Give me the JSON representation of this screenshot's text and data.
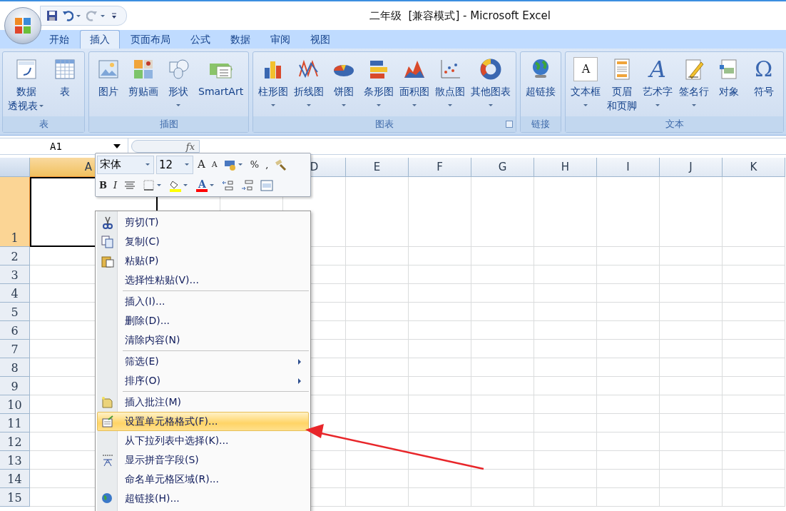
{
  "window": {
    "title": "二年级  [兼容模式] - Microsoft Excel"
  },
  "quick_access": [
    {
      "kind": "save"
    },
    {
      "kind": "undo",
      "dropdown": true
    },
    {
      "kind": "redo",
      "dropdown": true
    },
    {
      "kind": "customize"
    }
  ],
  "tabs": [
    {
      "label": "开始",
      "selected": false
    },
    {
      "label": "插入",
      "selected": true
    },
    {
      "label": "页面布局",
      "selected": false
    },
    {
      "label": "公式",
      "selected": false
    },
    {
      "label": "数据",
      "selected": false
    },
    {
      "label": "审阅",
      "selected": false
    },
    {
      "label": "视图",
      "selected": false
    }
  ],
  "ribbon_groups": [
    {
      "name": "表",
      "launcher": false,
      "buttons": [
        {
          "kind": "pivot",
          "label": "数据",
          "label2": "透视表",
          "dropdown": true
        },
        {
          "kind": "table",
          "label": "表",
          "dropdown": false
        }
      ]
    },
    {
      "name": "插图",
      "launcher": false,
      "buttons": [
        {
          "kind": "picture",
          "label": "图片",
          "dropdown": false
        },
        {
          "kind": "clipart",
          "label": "剪贴画",
          "dropdown": false
        },
        {
          "kind": "shapes",
          "label": "形状",
          "dropdown": true
        },
        {
          "kind": "smartart",
          "label": "SmartArt",
          "dropdown": false
        }
      ]
    },
    {
      "name": "图表",
      "launcher": true,
      "buttons": [
        {
          "kind": "column",
          "label": "柱形图",
          "dropdown": true
        },
        {
          "kind": "line",
          "label": "折线图",
          "dropdown": true
        },
        {
          "kind": "pie",
          "label": "饼图",
          "dropdown": true
        },
        {
          "kind": "bar",
          "label": "条形图",
          "dropdown": true
        },
        {
          "kind": "area",
          "label": "面积图",
          "dropdown": true
        },
        {
          "kind": "scatter",
          "label": "散点图",
          "dropdown": true
        },
        {
          "kind": "donut",
          "label": "其他图表",
          "dropdown": true
        }
      ]
    },
    {
      "name": "链接",
      "launcher": false,
      "buttons": [
        {
          "kind": "globe",
          "label": "超链接",
          "dropdown": false
        }
      ]
    },
    {
      "name": "文本",
      "launcher": false,
      "buttons": [
        {
          "kind": "textbox",
          "glyph": "A",
          "label": "文本框",
          "dropdown": true
        },
        {
          "kind": "header",
          "label": "页眉",
          "label2": "和页脚",
          "dropdown": false
        },
        {
          "kind": "wordart",
          "glyph": "A",
          "label": "艺术字",
          "dropdown": true
        },
        {
          "kind": "signature",
          "label": "签名行",
          "dropdown": true
        },
        {
          "kind": "object",
          "label": "对象",
          "dropdown": false
        },
        {
          "kind": "symbol",
          "glyph": "Ω",
          "label": "符号",
          "dropdown": false
        }
      ]
    }
  ],
  "formula_bar": {
    "name_box": "A1",
    "fx": "fx"
  },
  "mini_toolbar": {
    "font": "宋体",
    "size": "12",
    "row1": [
      {
        "kind": "grow",
        "glyph": "A"
      },
      {
        "kind": "shrink",
        "glyph": "A"
      },
      {
        "kind": "accounting",
        "dropdown": true
      },
      {
        "kind": "text",
        "glyph": "%"
      },
      {
        "kind": "text",
        "glyph": ","
      },
      {
        "kind": "painter"
      }
    ],
    "row2": [
      {
        "kind": "bold",
        "glyph": "B"
      },
      {
        "kind": "italic",
        "glyph": "I"
      },
      {
        "kind": "center"
      },
      {
        "kind": "borders",
        "dropdown": true
      },
      {
        "kind": "fill",
        "dropdown": true,
        "color": "#ffff00"
      },
      {
        "kind": "fontcolor",
        "glyph": "A",
        "dropdown": true,
        "color": "#ff0000"
      },
      {
        "kind": "incdec"
      },
      {
        "kind": "decdec"
      },
      {
        "kind": "merge"
      }
    ]
  },
  "columns": [
    {
      "label": "A",
      "selected": true
    },
    {
      "label": "D",
      "selected": false
    },
    {
      "label": "E",
      "selected": false
    },
    {
      "label": "F",
      "selected": false
    },
    {
      "label": "G",
      "selected": false
    },
    {
      "label": "H",
      "selected": false
    },
    {
      "label": "I",
      "selected": false
    },
    {
      "label": "J",
      "selected": false
    },
    {
      "label": "K",
      "selected": false
    }
  ],
  "rows": [
    {
      "label": "1",
      "selected": true
    },
    {
      "label": "2",
      "selected": false
    },
    {
      "label": "3",
      "selected": false
    },
    {
      "label": "4",
      "selected": false
    },
    {
      "label": "5",
      "selected": false
    },
    {
      "label": "6",
      "selected": false
    },
    {
      "label": "7",
      "selected": false
    },
    {
      "label": "8",
      "selected": false
    },
    {
      "label": "9",
      "selected": false
    },
    {
      "label": "10",
      "selected": false
    },
    {
      "label": "11",
      "selected": false
    },
    {
      "label": "12",
      "selected": false
    },
    {
      "label": "13",
      "selected": false
    },
    {
      "label": "14",
      "selected": false
    },
    {
      "label": "15",
      "selected": false
    }
  ],
  "context_menu": {
    "groups": [
      [
        {
          "label": "剪切(T)",
          "kind": "cut",
          "submenu": false,
          "selected": false
        },
        {
          "label": "复制(C)",
          "kind": "copy",
          "submenu": false,
          "selected": false
        },
        {
          "label": "粘贴(P)",
          "kind": "paste",
          "submenu": false,
          "selected": false
        },
        {
          "label": "选择性粘贴(V)...",
          "kind": "none",
          "submenu": false,
          "selected": false
        }
      ],
      [
        {
          "label": "插入(I)...",
          "kind": "none",
          "submenu": false,
          "selected": false
        },
        {
          "label": "删除(D)...",
          "kind": "none",
          "submenu": false,
          "selected": false
        },
        {
          "label": "清除内容(N)",
          "kind": "none",
          "submenu": false,
          "selected": false
        }
      ],
      [
        {
          "label": "筛选(E)",
          "kind": "none",
          "submenu": true,
          "selected": false
        },
        {
          "label": "排序(O)",
          "kind": "none",
          "submenu": true,
          "selected": false
        }
      ],
      [
        {
          "label": "插入批注(M)",
          "kind": "comment",
          "submenu": false,
          "selected": false
        },
        {
          "label": "设置单元格格式(F)...",
          "kind": "format",
          "submenu": false,
          "selected": true
        },
        {
          "label": "从下拉列表中选择(K)...",
          "kind": "none",
          "submenu": false,
          "selected": false
        },
        {
          "label": "显示拼音字段(S)",
          "kind": "pinyin",
          "submenu": false,
          "selected": false
        },
        {
          "label": "命名单元格区域(R)...",
          "kind": "none",
          "submenu": false,
          "selected": false
        },
        {
          "label": "超链接(H)...",
          "kind": "link",
          "submenu": false,
          "selected": false
        }
      ]
    ]
  }
}
